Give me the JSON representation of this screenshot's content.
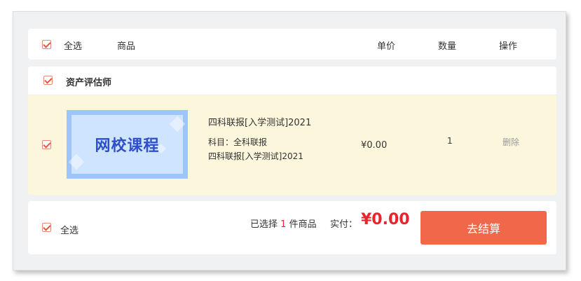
{
  "header": {
    "select_all_label": "全选",
    "col_product": "商品",
    "col_price": "单价",
    "col_quantity": "数量",
    "col_action": "操作"
  },
  "shop": {
    "name": "资产评估师"
  },
  "item": {
    "thumbnail_text": "网校课程",
    "title": "四科联报[入学测试]2021",
    "subject_line": "科目：全科联报",
    "subject_detail": "四科联报[入学测试]2021",
    "price": "¥0.00",
    "quantity": "1",
    "delete_label": "删除"
  },
  "footer": {
    "select_all_label": "全选",
    "selected_prefix": "已选择",
    "selected_count": "1",
    "selected_suffix": "件商品",
    "paid_label": "实付：",
    "total": "¥0.00",
    "checkout_label": "去结算"
  },
  "colors": {
    "accent": "#f1674a",
    "price_red": "#e8252b",
    "item_bg": "#fcf7dc",
    "check": "#e4573e"
  }
}
